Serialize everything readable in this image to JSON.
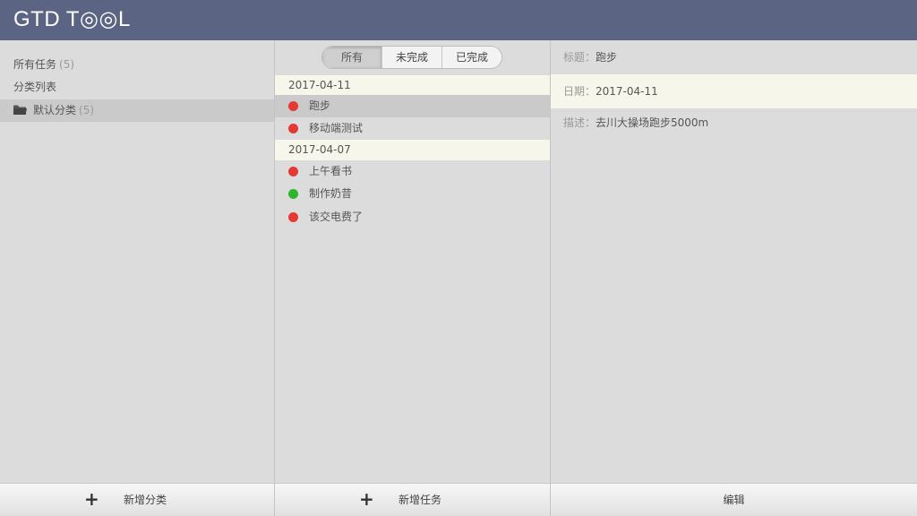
{
  "app": {
    "title": "GTD T◎◎L"
  },
  "sidebar": {
    "all_tasks": {
      "label": "所有任务",
      "count": "(5)"
    },
    "category_header": "分类列表",
    "categories": [
      {
        "label": "默认分类",
        "count": "(5)",
        "icon": "folder-icon"
      }
    ],
    "add_button": {
      "icon": "plus-icon",
      "label": "新增分类"
    }
  },
  "tasks": {
    "filters": [
      "所有",
      "未完成",
      "已完成"
    ],
    "active_filter": "所有",
    "groups": [
      {
        "date": "2017-04-11",
        "items": [
          {
            "label": "跑步",
            "status_color": "#e53935"
          },
          {
            "label": "移动端测试",
            "status_color": "#e53935"
          }
        ]
      },
      {
        "date": "2017-04-07",
        "items": [
          {
            "label": "上午看书",
            "status_color": "#e53935"
          },
          {
            "label": "制作奶昔",
            "status_color": "#2db52d"
          },
          {
            "label": "该交电费了",
            "status_color": "#e53935"
          }
        ]
      }
    ],
    "add_button": {
      "icon": "plus-icon",
      "label": "新增任务"
    }
  },
  "detail": {
    "title_label": "标题：",
    "title_value": "跑步",
    "date_label": "日期：",
    "date_value": "2017-04-11",
    "desc_label": "描述：",
    "desc_value": "去川大操场跑步5000m",
    "edit_button": "编辑"
  },
  "colors": {
    "header": "#5b6482",
    "incomplete": "#e53935",
    "complete": "#2db52d"
  }
}
